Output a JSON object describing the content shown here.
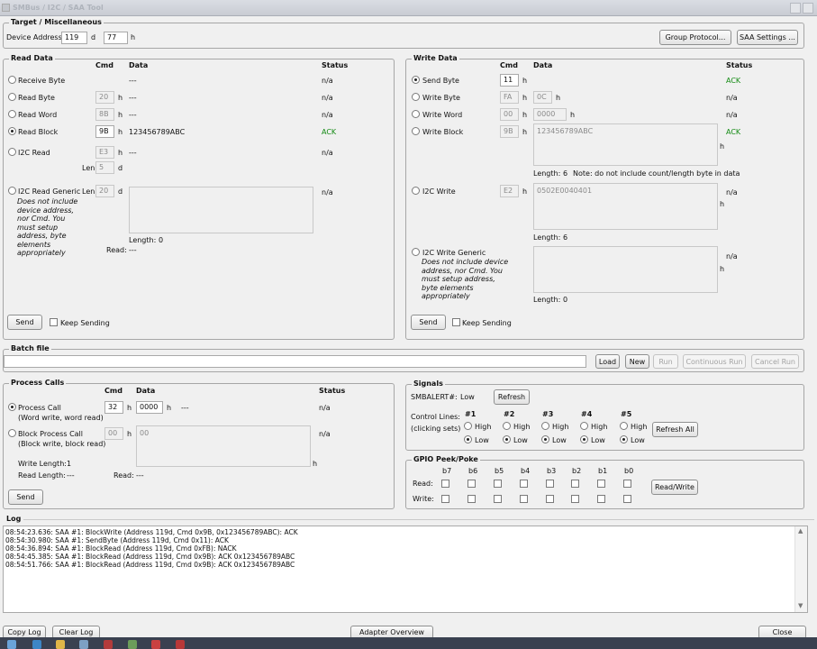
{
  "window": {
    "title": "SMBus / I2C / SAA Tool"
  },
  "target": {
    "title": "Target / Miscellaneous",
    "device_address_label": "Device Address:",
    "addr_dec": "119",
    "d": "d",
    "addr_hex": "77",
    "h": "h",
    "group_protocol_btn": "Group Protocol...",
    "saa_settings_btn": "SAA Settings ..."
  },
  "read": {
    "title": "Read Data",
    "col_cmd": "Cmd",
    "col_data": "Data",
    "col_status": "Status",
    "receive_byte": {
      "label": "Receive Byte",
      "data": "---",
      "status": "n/a"
    },
    "read_byte": {
      "label": "Read Byte",
      "cmd": "20",
      "h": "h",
      "data": "---",
      "status": "n/a"
    },
    "read_word": {
      "label": "Read Word",
      "cmd": "8B",
      "h": "h",
      "data": "---",
      "status": "n/a"
    },
    "read_block": {
      "label": "Read Block",
      "cmd": "9B",
      "h": "h",
      "data": "123456789ABC",
      "status": "ACK"
    },
    "i2c_read": {
      "label": "I2C Read",
      "cmd": "E3",
      "h": "h",
      "data": "---",
      "status": "n/a",
      "len_label": "Len",
      "len": "5",
      "d": "d"
    },
    "i2c_read_generic": {
      "label": "I2C Read Generic",
      "len_label": "Len",
      "len": "20",
      "d": "d",
      "note": "Does not include device address, nor Cmd. You must setup address, byte elements appropriately",
      "status": "n/a",
      "length_label": "Length:",
      "length": "0",
      "read_label": "Read:",
      "read": "---"
    },
    "send_btn": "Send",
    "keep_sending": "Keep Sending"
  },
  "write": {
    "title": "Write Data",
    "col_cmd": "Cmd",
    "col_data": "Data",
    "col_status": "Status",
    "send_byte": {
      "label": "Send Byte",
      "cmd": "11",
      "h": "h",
      "status": "ACK"
    },
    "write_byte": {
      "label": "Write Byte",
      "cmd": "FA",
      "h": "h",
      "data": "0C",
      "h2": "h",
      "status": "n/a"
    },
    "write_word": {
      "label": "Write Word",
      "cmd": "00",
      "h": "h",
      "data": "0000",
      "h2": "h",
      "status": "n/a"
    },
    "write_block": {
      "label": "Write Block",
      "cmd": "9B",
      "h": "h",
      "data": "123456789ABC",
      "h2": "h",
      "status": "ACK",
      "length_label": "Length:",
      "length": "6",
      "note": "Note: do not include count/length byte in data"
    },
    "i2c_write": {
      "label": "I2C Write",
      "cmd": "E2",
      "h": "h",
      "data": "0502E0040401",
      "h2": "h",
      "status": "n/a",
      "length_label": "Length:",
      "length": "6"
    },
    "i2c_write_generic": {
      "label": "I2C Write Generic",
      "note": "Does not include device address, nor Cmd. You must setup address, byte elements appropriately",
      "h": "h",
      "status": "n/a",
      "length_label": "Length:",
      "length": "0"
    },
    "send_btn": "Send",
    "keep_sending": "Keep Sending"
  },
  "batch": {
    "title": "Batch file",
    "file": "",
    "load": "Load",
    "new": "New",
    "run": "Run",
    "continuous_run": "Continuous Run",
    "cancel_run": "Cancel Run"
  },
  "process": {
    "title": "Process Calls",
    "col_cmd": "Cmd",
    "col_data": "Data",
    "col_status": "Status",
    "process_call": {
      "label": "Process Call",
      "sub": "(Word write, word read)",
      "cmd": "32",
      "h": "h",
      "data": "0000",
      "h2": "h",
      "result": "---",
      "status": "n/a"
    },
    "block_process_call": {
      "label": "Block Process Call",
      "sub": "(Block write, block read)",
      "cmd": "00",
      "h": "h",
      "data": "00",
      "h2": "h",
      "status": "n/a"
    },
    "write_length_label": "Write Length:",
    "write_length": "1",
    "read_length_label": "Read Length:",
    "read_length": "---",
    "read_label": "Read:",
    "read": "---",
    "send_btn": "Send"
  },
  "signals": {
    "title": "Signals",
    "smbalert_label": "SMBALERT#:",
    "smbalert": "Low",
    "refresh": "Refresh",
    "control_lines": "Control Lines:",
    "clicking_sets": "(clicking sets)",
    "lines": [
      {
        "name": "#1",
        "high": "High",
        "low": "Low"
      },
      {
        "name": "#2",
        "high": "High",
        "low": "Low"
      },
      {
        "name": "#3",
        "high": "High",
        "low": "Low"
      },
      {
        "name": "#4",
        "high": "High",
        "low": "Low"
      },
      {
        "name": "#5",
        "high": "High",
        "low": "Low"
      }
    ],
    "refresh_all": "Refresh All"
  },
  "gpio": {
    "title": "GPIO Peek/Poke",
    "bits": [
      "b7",
      "b6",
      "b5",
      "b4",
      "b3",
      "b2",
      "b1",
      "b0"
    ],
    "read_label": "Read:",
    "write_label": "Write:",
    "rw_btn": "Read/Write"
  },
  "log": {
    "title": "Log",
    "lines": [
      "08:54:23.636: SAA #1: BlockWrite (Address 119d, Cmd 0x9B, 0x123456789ABC): ACK",
      "08:54:30.980: SAA #1: SendByte (Address 119d, Cmd 0x11): ACK",
      "08:54:36.894: SAA #1: BlockRead (Address 119d, Cmd 0xFB): NACK",
      "08:54:45.385: SAA #1: BlockRead (Address 119d, Cmd 0x9B): ACK 0x123456789ABC",
      "08:54:51.766: SAA #1: BlockRead (Address 119d, Cmd 0x9B): ACK 0x123456789ABC"
    ]
  },
  "footer": {
    "copy_log": "Copy Log",
    "clear_log": "Clear Log",
    "adapter_overview": "Adapter Overview",
    "close": "Close"
  },
  "colors": {
    "ack": "#138a13",
    "titlebar": "#c9ccd3",
    "taskbar": "#3a4150"
  }
}
